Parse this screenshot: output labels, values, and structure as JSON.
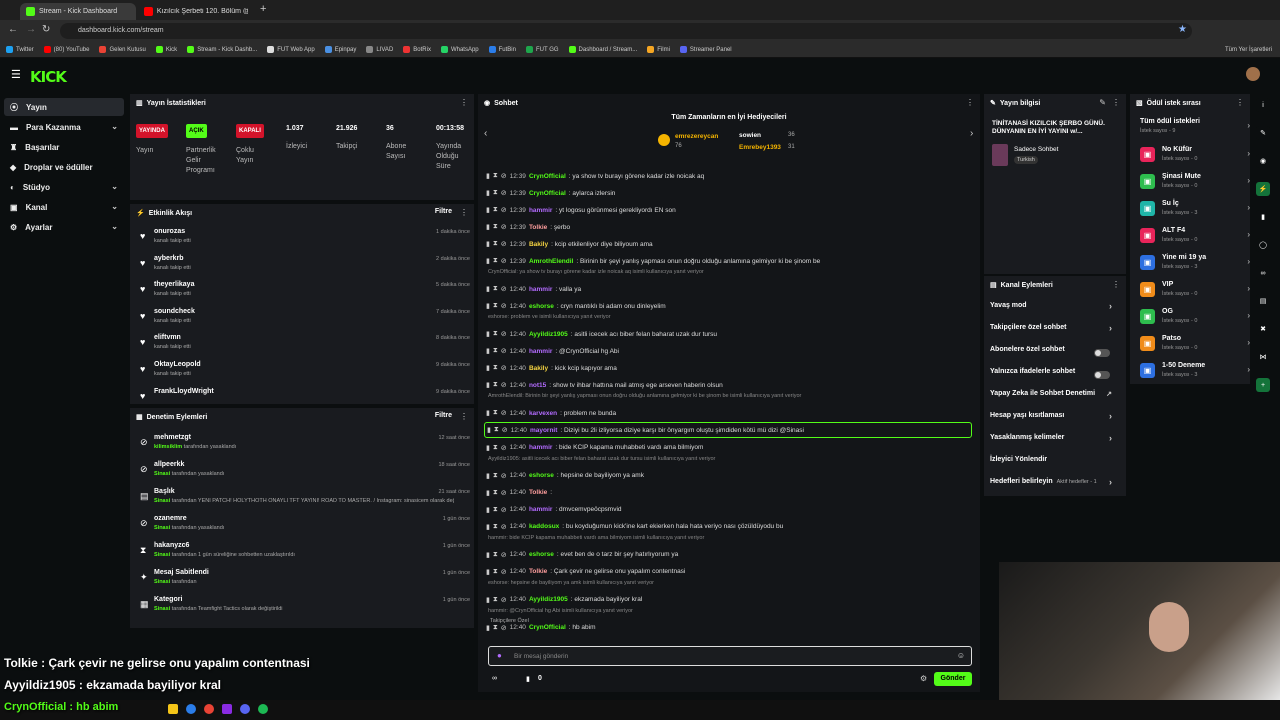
{
  "browser": {
    "tabs": [
      {
        "label": "Stream - Kick Dashboard",
        "color": "#53fc18"
      },
      {
        "label": "Kızılcık Şerbeti 120. Bölüm @sh...",
        "color": "#ff0000"
      }
    ],
    "url": "dashboard.kick.com/stream",
    "bookmarks": [
      "Twitter",
      "(80) YouTube",
      "Gelen Kutusu",
      "Kick",
      "Stream - Kick Dashb...",
      "FUT Web App",
      "Epinpay",
      "LIVAD",
      "BotRix",
      "WhatsApp",
      "FutBin",
      "FUT GG",
      "Dashboard / Stream...",
      "Filmi",
      "Streamer Panel"
    ],
    "bookmarks_right": "Tüm Yer İşaretleri"
  },
  "brand": {
    "logo": "KICK",
    "accent": "#53fc18"
  },
  "nav": {
    "items": [
      {
        "label": "Yayın",
        "icon": "broadcast-icon",
        "expand": false
      },
      {
        "label": "Para Kazanma",
        "icon": "money-icon",
        "expand": true
      },
      {
        "label": "Başarılar",
        "icon": "trophy-icon",
        "expand": false
      },
      {
        "label": "Droplar ve ödüller",
        "icon": "gift-icon",
        "expand": false
      },
      {
        "label": "Stüdyo",
        "icon": "studio-icon",
        "expand": true
      },
      {
        "label": "Kanal",
        "icon": "channel-icon",
        "expand": true
      },
      {
        "label": "Ayarlar",
        "icon": "settings-icon",
        "expand": true
      }
    ]
  },
  "stats": {
    "title": "Yayın İstatistikleri",
    "cols": [
      {
        "value": "YAYINDA",
        "label": "Yayın",
        "badge": "#d3132a"
      },
      {
        "value": "AÇIK",
        "label": "Partnerlik Gelir Programı",
        "badge": "#53fc18"
      },
      {
        "value": "KAPALI",
        "label": "Çoklu Yayın",
        "badge": "#d3132a"
      },
      {
        "value": "1.037",
        "label": "İzleyici"
      },
      {
        "value": "21.926",
        "label": "Takipçi"
      },
      {
        "value": "36",
        "label": "Abone Sayısı"
      },
      {
        "value": "00:13:58",
        "label": "Yayında Olduğu Süre"
      }
    ]
  },
  "events": {
    "title": "Etkinlik Akışı",
    "filter": "Filtre",
    "items": [
      {
        "name": "onurozas",
        "sub": "kanalı takip etti",
        "time": "1 dakika önce"
      },
      {
        "name": "ayberkrb",
        "sub": "kanalı takip etti",
        "time": "2 dakika önce"
      },
      {
        "name": "theyerlikaya",
        "sub": "kanalı takip etti",
        "time": "5 dakika önce"
      },
      {
        "name": "soundcheck",
        "sub": "kanalı takip etti",
        "time": "7 dakika önce"
      },
      {
        "name": "eliftvmn",
        "sub": "kanalı takip etti",
        "time": "8 dakika önce"
      },
      {
        "name": "OktayLeopold",
        "sub": "kanalı takip etti",
        "time": "9 dakika önce"
      },
      {
        "name": "FrankLloydWright",
        "sub": "",
        "time": "9 dakika önce"
      }
    ]
  },
  "audit": {
    "title": "Denetim Eylemleri",
    "filter": "Filtre",
    "items": [
      {
        "icon": "ban-icon",
        "name": "mehmetzgt",
        "actor": "kilimsiklim",
        "text": "tarafından yasaklandı",
        "time": "12 saat önce"
      },
      {
        "icon": "ban-icon",
        "name": "allpeerkk",
        "actor": "Sinasi",
        "text": "tarafından yasaklandı",
        "time": "18 saat önce"
      },
      {
        "icon": "title-icon",
        "name": "Başlık",
        "actor": "Sinasi",
        "text": "tarafından YENİ PATCH! HOLYTHOTH ONAYLI TFT YAYINI! ROAD TO MASTER. / Instagram: sinasicem olarak değiştirildi",
        "time": "21 saat önce"
      },
      {
        "icon": "ban-icon",
        "name": "ozanemre",
        "actor": "Sinasi",
        "text": "tarafından yasaklandı",
        "time": "1 gün önce"
      },
      {
        "icon": "timeout-icon",
        "name": "hakanyzc6",
        "actor": "Sinasi",
        "text": "tarafından 1 gün süreliğine sohbetten uzaklaştırıldı",
        "time": "1 gün önce"
      },
      {
        "icon": "pin-icon",
        "name": "Mesaj Sabitlendi",
        "actor": "Sinasi",
        "text": "tarafından",
        "time": "1 gün önce"
      },
      {
        "icon": "category-icon",
        "name": "Kategori",
        "actor": "Sinasi",
        "text": "tarafından Teamfight Tactics olarak değiştirildi",
        "time": "1 gün önce"
      }
    ]
  },
  "chat": {
    "title": "Sohbet",
    "gifters_title": "Tüm Zamanların en İyi Hediyecileri",
    "gifters": [
      {
        "name": "emrezereycan",
        "count": "76"
      },
      {
        "name": "sowien",
        "count": "36"
      },
      {
        "name": "Emrebey1393",
        "count": "31"
      }
    ],
    "lines": [
      {
        "time": "12:39",
        "user": "CrynOfficial",
        "color": "#53fc18",
        "text": ": ya show tv burayı görene kadar izle noicak aq"
      },
      {
        "time": "12:39",
        "user": "CrynOfficial",
        "color": "#53fc18",
        "text": ": aylarca izlersin"
      },
      {
        "time": "12:39",
        "user": "hammir",
        "color": "#b36bff",
        "text": ": yt logosu görünmesi gerekliyordı EN son"
      },
      {
        "time": "12:39",
        "user": "Tolkie",
        "color": "#ff9e9e",
        "text": ": şerbo"
      },
      {
        "time": "12:39",
        "user": "Bakily",
        "color": "#f5d442",
        "text": ": kcip etkilenliyor diye biliyoum ama"
      },
      {
        "time": "12:39",
        "user": "AmrothElendil",
        "color": "#53fc18",
        "text": ": Birinin bir şeyi yanlış yapması onun doğru olduğu anlamına gelmiyor ki be şinom be"
      },
      {
        "reply": "CrynOfficial: ya show tv burayı görene kadar izle noicak aq isimli kullanıcıya yanıt veriyor"
      },
      {
        "time": "12:40",
        "user": "hammir",
        "color": "#b36bff",
        "text": ": valla ya"
      },
      {
        "time": "12:40",
        "user": "eshorse",
        "color": "#53fc18",
        "text": ": cryn mantıklı bi adam onu dinleyelim"
      },
      {
        "reply": "eshorse: problem ve isimli kullanıcıya yanıt veriyor"
      },
      {
        "time": "12:40",
        "user": "Ayyildiz1905",
        "color": "#53fc18",
        "text": ": asitli icecek acı biber felan baharat uzak dur tursu"
      },
      {
        "time": "12:40",
        "user": "hammir",
        "color": "#b36bff",
        "text": ": @CrynOfficial hg Abi"
      },
      {
        "time": "12:40",
        "user": "Bakily",
        "color": "#f5d442",
        "text": ": kick kcip kapıyor ama"
      },
      {
        "time": "12:40",
        "user": "not15",
        "color": "#b36bff",
        "text": ": show tv ihbar hattına mail atmış ege arseven haberin olsun"
      },
      {
        "reply": "AmrothElendil: Birinin bir şeyi yanlış yapması onun doğru olduğu anlamına gelmiyor ki be şinom be isimli kullanıcıya yanıt veriyor"
      },
      {
        "time": "12:40",
        "user": "karvexen",
        "color": "#b36bff",
        "text": ": problem ne bunda"
      },
      {
        "time": "12:40",
        "user": "mayornit",
        "color": "#b36bff",
        "text": ": Diziyi bu 2li izliyorsa diziye karşı bir önyargım oluştu şimdiden kötü mü dizi @Sinasi",
        "highlight": true
      },
      {
        "time": "12:40",
        "user": "hammir",
        "color": "#b36bff",
        "text": ": bide KCIP kapama muhabbeti vardı ama bilmiyom"
      },
      {
        "reply": "Ayyildiz1905: asitli icecek acı biber felan baharat uzak dur tursu isimli kullanıcıya yanıt veriyor"
      },
      {
        "time": "12:40",
        "user": "eshorse",
        "color": "#53fc18",
        "text": ": hepsine de bayiliyom ya amk"
      },
      {
        "time": "12:40",
        "user": "Tolkie",
        "color": "#ff9e9e",
        "text": ":"
      },
      {
        "time": "12:40",
        "user": "hammir",
        "color": "#b36bff",
        "text": ": dmvcemvpeöcpsmvid"
      },
      {
        "time": "12:40",
        "user": "kaddosux",
        "color": "#53fc18",
        "text": ": bu koyduğumun kick'ine kart ekierken hala hata veriyo nası çözüldüyodu bu"
      },
      {
        "reply": "hammir: bide KCIP kapama muhabbeti vardı ama bilmiyom isimli kullanıcıya yanıt veriyor"
      },
      {
        "time": "12:40",
        "user": "eshorse",
        "color": "#53fc18",
        "text": ": evet ben de o tarz bir şey hatırlıyorum ya"
      },
      {
        "time": "12:40",
        "user": "Tolkie",
        "color": "#ff9e9e",
        "text": ": Çark çevir ne gelirse onu yapalım contentnasi"
      },
      {
        "reply": "eshorse: hepsine de bayiliyom ya amk isimli kullanıcıya yanıt veriyor"
      },
      {
        "time": "12:40",
        "user": "Ayyildiz1905",
        "color": "#53fc18",
        "text": ": ekzamada bayiliyor kral"
      },
      {
        "reply": "hammir: @CrynOfficial hg Abi isimli kullanıcıya yanıt veriyor"
      },
      {
        "time": "12:40",
        "user": "CrynOfficial",
        "color": "#53fc18",
        "text": ": hb abim"
      }
    ],
    "followers_only": "Takipçilere Özel",
    "input_placeholder": "Bir mesaj gönderin",
    "points": "0",
    "send": "Gönder"
  },
  "streaminfo": {
    "title": "Yayın bilgisi",
    "stream_title": "TİNİTANASİ KIZILCIK ŞERBO GÜNÜ. DÜNYANIN EN İYİ YAYINI w/...",
    "category": "Sadece Sohbet",
    "tag": "Turkish"
  },
  "actions": {
    "title": "Kanal Eylemleri",
    "items": [
      {
        "label": "Yavaş mod",
        "kind": "chev"
      },
      {
        "label": "Takipçilere özel sohbet",
        "kind": "chev"
      },
      {
        "label": "Abonelere özel sohbet",
        "kind": "toggle"
      },
      {
        "label": "Yalnızca ifadelerle sohbet",
        "kind": "toggle"
      },
      {
        "label": "Yapay Zeka ile Sohbet Denetimi",
        "kind": "ext"
      },
      {
        "label": "Hesap yaşı kısıtlaması",
        "kind": "chev"
      },
      {
        "label": "Yasaklanmış kelimeler",
        "kind": "chev"
      },
      {
        "label": "İzleyici Yönlendir",
        "kind": "none"
      },
      {
        "label": "Hedefleri belirleyin",
        "kind": "chev",
        "extra": "Aktif hedefler - 1"
      }
    ]
  },
  "rewards": {
    "title": "Ödül istek sırası",
    "all": "Tüm ödül istekleri",
    "all_sub": "İstek sayısı - 9",
    "items": [
      {
        "label": "No Küfür",
        "sub": "İstek sayısı - 0",
        "color": "#e8245a"
      },
      {
        "label": "Şinasi Mute",
        "sub": "İstek sayısı - 0",
        "color": "#2ebd4e"
      },
      {
        "label": "Su İç",
        "sub": "İstek sayısı - 3",
        "color": "#1fb5a8"
      },
      {
        "label": "ALT F4",
        "sub": "İstek sayısı - 0",
        "color": "#e8245a"
      },
      {
        "label": "Yine mi 19 ya",
        "sub": "İstek sayısı - 3",
        "color": "#2d6fe0"
      },
      {
        "label": "VIP",
        "sub": "İstek sayısı - 0",
        "color": "#f08c1a"
      },
      {
        "label": "OG",
        "sub": "İstek sayısı - 0",
        "color": "#2ebd4e"
      },
      {
        "label": "Patso",
        "sub": "İstek sayısı - 0",
        "color": "#f08c1a"
      },
      {
        "label": "1-50 Deneme",
        "sub": "İstek sayısı - 3",
        "color": "#2d6fe0"
      }
    ]
  },
  "overlay": {
    "line1": "Tolkie : Çark çevir ne gelirse onu yapalım contentnasi",
    "line2": "Ayyildiz1905 : ekzamada bayiliyor kral",
    "line3": "CrynOfficial : hb abim"
  }
}
